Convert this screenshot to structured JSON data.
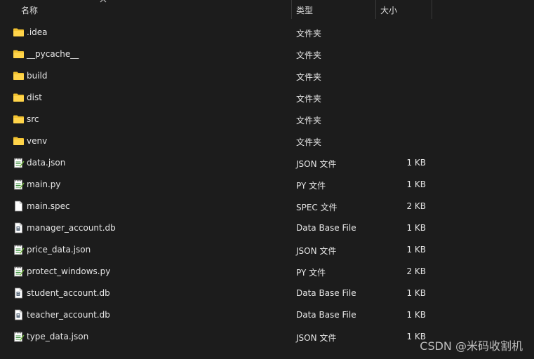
{
  "header": {
    "name_label": "名称",
    "type_label": "类型",
    "size_label": "大小"
  },
  "files": [
    {
      "name": ".idea",
      "type": "文件夹",
      "size": "",
      "icon": "folder-icon"
    },
    {
      "name": "__pycache__",
      "type": "文件夹",
      "size": "",
      "icon": "folder-icon"
    },
    {
      "name": "build",
      "type": "文件夹",
      "size": "",
      "icon": "folder-icon"
    },
    {
      "name": "dist",
      "type": "文件夹",
      "size": "",
      "icon": "folder-icon"
    },
    {
      "name": "src",
      "type": "文件夹",
      "size": "",
      "icon": "folder-icon"
    },
    {
      "name": "venv",
      "type": "文件夹",
      "size": "",
      "icon": "folder-icon"
    },
    {
      "name": "data.json",
      "type": "JSON 文件",
      "size": "1 KB",
      "icon": "notepad-file-icon"
    },
    {
      "name": "main.py",
      "type": "PY 文件",
      "size": "1 KB",
      "icon": "notepad-file-icon"
    },
    {
      "name": "main.spec",
      "type": "SPEC 文件",
      "size": "2 KB",
      "icon": "blank-file-icon"
    },
    {
      "name": "manager_account.db",
      "type": "Data Base File",
      "size": "1 KB",
      "icon": "db-file-icon"
    },
    {
      "name": "price_data.json",
      "type": "JSON 文件",
      "size": "1 KB",
      "icon": "notepad-file-icon"
    },
    {
      "name": "protect_windows.py",
      "type": "PY 文件",
      "size": "2 KB",
      "icon": "notepad-file-icon"
    },
    {
      "name": "student_account.db",
      "type": "Data Base File",
      "size": "1 KB",
      "icon": "db-file-icon"
    },
    {
      "name": "teacher_account.db",
      "type": "Data Base File",
      "size": "1 KB",
      "icon": "db-file-icon"
    },
    {
      "name": "type_data.json",
      "type": "JSON 文件",
      "size": "1 KB",
      "icon": "notepad-file-icon"
    }
  ],
  "watermark": "CSDN @米码收割机"
}
